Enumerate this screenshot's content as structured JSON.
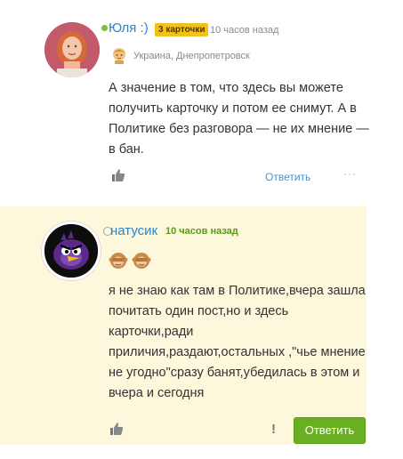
{
  "comments": [
    {
      "author": "Юля :)",
      "badge": "3 карточки",
      "time": "10 часов назад",
      "location": "Украина, Днепропетровск",
      "text": "А значение в том, что здесь вы можете получить карточку и потом ее снимут. А в Политике без разговора — не их мнение — в бан.",
      "reply_label": "Ответить",
      "more_label": "···"
    },
    {
      "author": "натусик",
      "time": "10 часов назад",
      "text": "я не знаю как там в Политике,вчера зашла почитать один пост,но и здесь карточки,ради приличия,раздают,остальных ,\"чье мнение не угодно\"сразу банят,убедилась в этом и вчера и сегодня",
      "flag_label": "!",
      "reply_label": "Ответить"
    }
  ],
  "colors": {
    "link": "#2b86c8",
    "badge": "#f2c21b",
    "highlight_bg": "#fdf7dc",
    "accent_green": "#6aae23"
  }
}
